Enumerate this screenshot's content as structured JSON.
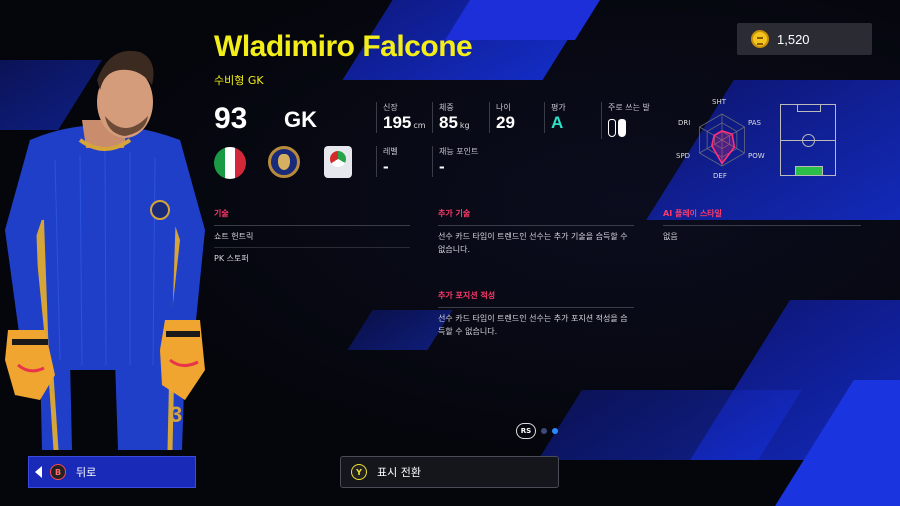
{
  "currency": {
    "icon": "coin-icon",
    "amount": "1,520"
  },
  "player": {
    "name": "Wladimiro Falcone",
    "playstyle": "수비형 GK",
    "overall": "93",
    "position": "GK",
    "nationality_icon": "italy-flag-icon",
    "club_icon": "club-badge-icon",
    "league_icon": "league-logo-icon"
  },
  "stats": {
    "height": {
      "label": "신장",
      "value": "195",
      "unit": "cm"
    },
    "weight": {
      "label": "체중",
      "value": "85",
      "unit": "kg"
    },
    "age": {
      "label": "나이",
      "value": "29"
    },
    "rating": {
      "label": "평가",
      "value": "A"
    },
    "foot": {
      "label": "주로 쓰는 발",
      "icon": "right-foot-icon"
    },
    "level": {
      "label": "레벨",
      "value": "-"
    },
    "skill_points": {
      "label": "재능 포인트",
      "value": "-"
    }
  },
  "radar": {
    "labels": {
      "top": "SHT",
      "top_right": "PAS",
      "bottom_right": "POW",
      "bottom": "DEF",
      "bottom_left": "SPD",
      "top_left": "DRI"
    },
    "values": [
      0.35,
      0.45,
      0.55,
      0.9,
      0.45,
      0.35
    ]
  },
  "sections": {
    "skills": {
      "title": "기술",
      "items": [
        "쇼트 헌트릭",
        "PK 스토퍼"
      ]
    },
    "extra_skills": {
      "title": "추가 기술",
      "text": "선수 카드 타입이 트렌드인 선수는 추가 기술을 습득할 수 없습니다."
    },
    "extra_positions": {
      "title": "추가 포지션 적성",
      "text": "선수 카드 타입이 트렌드인 선수는 추가 포지션 적성을 습득할 수 없습니다."
    },
    "ai_style": {
      "title": "AI 플레이 스타일",
      "value": "없음"
    }
  },
  "pager": {
    "stick": "RS",
    "pages": 2,
    "active": 2
  },
  "buttons": {
    "back": {
      "badge": "B",
      "label": "뒤로"
    },
    "switch": {
      "badge": "Y",
      "label": "표시 전환"
    }
  },
  "colors": {
    "name": "#f3ee1a",
    "accent": "#ff3a6a",
    "grade": "#2fe0c6",
    "back_button": "#1a2ab8"
  }
}
